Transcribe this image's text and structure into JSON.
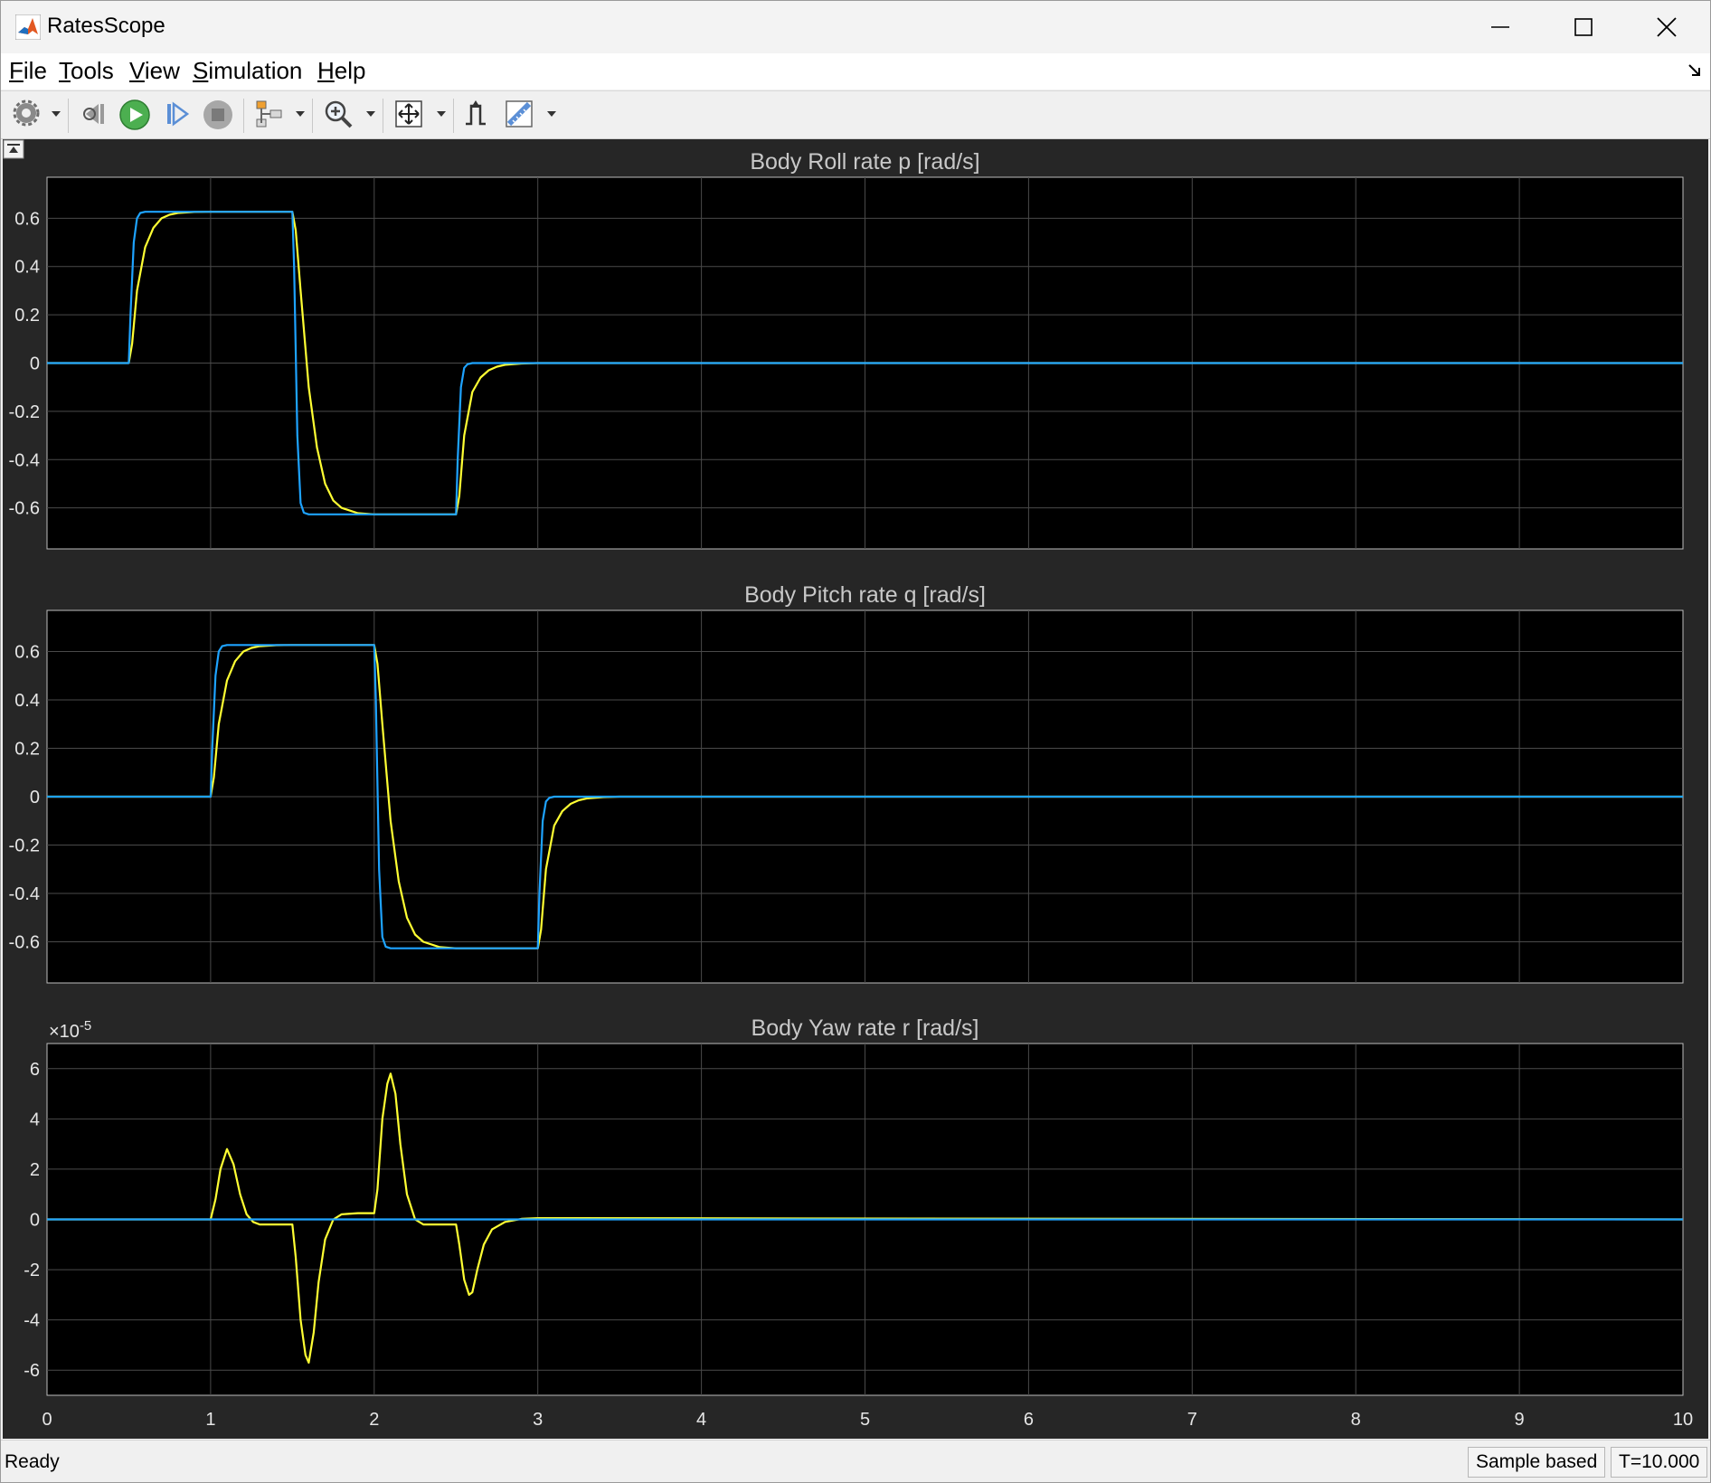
{
  "window": {
    "title": "RatesScope"
  },
  "menu": [
    {
      "pre": "",
      "ul": "F",
      "post": "ile"
    },
    {
      "pre": "",
      "ul": "T",
      "post": "ools"
    },
    {
      "pre": "",
      "ul": "V",
      "post": "iew"
    },
    {
      "pre": "",
      "ul": "S",
      "post": "imulation"
    },
    {
      "pre": "",
      "ul": "H",
      "post": "elp"
    }
  ],
  "toolbar": {
    "buttons": [
      "settings-icon",
      "step-back-icon",
      "run-icon",
      "step-forward-icon",
      "stop-icon",
      "signal-select-icon",
      "zoom-in-icon",
      "autoscale-icon",
      "triggers-icon",
      "measurements-icon"
    ]
  },
  "status": {
    "text": "Ready",
    "mode": "Sample based",
    "time": "T=10.000"
  },
  "colors": {
    "setpoint": "#1ea3ff",
    "response": "#ffff33",
    "background": "#000000",
    "frame": "#262626"
  },
  "chart_data": [
    {
      "type": "line",
      "title": "Body Roll rate p [rad/s]",
      "xlim": [
        0,
        10
      ],
      "ylim": [
        -0.77,
        0.77
      ],
      "yticks": [
        -0.6,
        -0.4,
        -0.2,
        0,
        0.2,
        0.4,
        0.6
      ],
      "ytick_labels": [
        "-0.6",
        "-0.4",
        "-0.2",
        "0",
        "0.2",
        "0.4",
        "0.6"
      ],
      "grid": true,
      "series": [
        {
          "color": "#ffff33",
          "x": [
            0,
            0.5,
            0.52,
            0.55,
            0.6,
            0.65,
            0.7,
            0.75,
            0.8,
            0.9,
            1.0,
            1.5,
            1.52,
            1.55,
            1.6,
            1.65,
            1.7,
            1.75,
            1.8,
            1.9,
            2.0,
            2.5,
            2.52,
            2.55,
            2.6,
            2.65,
            2.7,
            2.75,
            2.8,
            2.9,
            3.0,
            10
          ],
          "y": [
            0,
            0,
            0.08,
            0.3,
            0.48,
            0.56,
            0.6,
            0.615,
            0.622,
            0.626,
            0.627,
            0.627,
            0.55,
            0.3,
            -0.1,
            -0.35,
            -0.5,
            -0.57,
            -0.6,
            -0.622,
            -0.627,
            -0.627,
            -0.55,
            -0.3,
            -0.12,
            -0.06,
            -0.03,
            -0.015,
            -0.007,
            -0.002,
            0,
            0
          ]
        },
        {
          "color": "#1ea3ff",
          "x": [
            0,
            0.5,
            0.51,
            0.53,
            0.55,
            0.57,
            0.6,
            1.5,
            1.51,
            1.53,
            1.55,
            1.57,
            1.6,
            2.5,
            2.51,
            2.53,
            2.55,
            2.57,
            2.6,
            10
          ],
          "y": [
            0,
            0,
            0.2,
            0.5,
            0.6,
            0.622,
            0.627,
            0.627,
            0.4,
            -0.3,
            -0.58,
            -0.62,
            -0.627,
            -0.627,
            -0.4,
            -0.1,
            -0.02,
            -0.005,
            0,
            0
          ]
        }
      ]
    },
    {
      "type": "line",
      "title": "Body Pitch rate q [rad/s]",
      "xlim": [
        0,
        10
      ],
      "ylim": [
        -0.77,
        0.77
      ],
      "yticks": [
        -0.6,
        -0.4,
        -0.2,
        0,
        0.2,
        0.4,
        0.6
      ],
      "ytick_labels": [
        "-0.6",
        "-0.4",
        "-0.2",
        "0",
        "0.2",
        "0.4",
        "0.6"
      ],
      "grid": true,
      "series": [
        {
          "color": "#ffff33",
          "x": [
            0,
            1.0,
            1.02,
            1.05,
            1.1,
            1.15,
            1.2,
            1.25,
            1.3,
            1.4,
            1.5,
            2.0,
            2.02,
            2.05,
            2.1,
            2.15,
            2.2,
            2.25,
            2.3,
            2.4,
            2.5,
            3.0,
            3.02,
            3.05,
            3.1,
            3.15,
            3.2,
            3.25,
            3.3,
            3.4,
            3.5,
            10
          ],
          "y": [
            0,
            0,
            0.08,
            0.3,
            0.48,
            0.56,
            0.6,
            0.615,
            0.622,
            0.626,
            0.627,
            0.627,
            0.55,
            0.3,
            -0.1,
            -0.35,
            -0.5,
            -0.57,
            -0.6,
            -0.622,
            -0.627,
            -0.627,
            -0.55,
            -0.3,
            -0.12,
            -0.06,
            -0.03,
            -0.015,
            -0.007,
            -0.002,
            0,
            0
          ]
        },
        {
          "color": "#1ea3ff",
          "x": [
            0,
            1.0,
            1.01,
            1.03,
            1.05,
            1.07,
            1.1,
            2.0,
            2.01,
            2.03,
            2.05,
            2.07,
            2.1,
            3.0,
            3.01,
            3.03,
            3.05,
            3.07,
            3.1,
            10
          ],
          "y": [
            0,
            0,
            0.2,
            0.5,
            0.6,
            0.622,
            0.627,
            0.627,
            0.4,
            -0.3,
            -0.58,
            -0.62,
            -0.627,
            -0.627,
            -0.4,
            -0.1,
            -0.02,
            -0.005,
            0,
            0
          ]
        }
      ]
    },
    {
      "type": "line",
      "title": "Body Yaw rate r [rad/s]",
      "exponent_label": "×10",
      "exponent_power": "-5",
      "xlim": [
        0,
        10
      ],
      "ylim": [
        -7,
        7
      ],
      "yticks": [
        -6,
        -4,
        -2,
        0,
        2,
        4,
        6
      ],
      "ytick_labels": [
        "-6",
        "-4",
        "-2",
        "0",
        "2",
        "4",
        "6"
      ],
      "xticks": [
        0,
        1,
        2,
        3,
        4,
        5,
        6,
        7,
        8,
        9,
        10
      ],
      "xtick_labels": [
        "0",
        "1",
        "2",
        "3",
        "4",
        "5",
        "6",
        "7",
        "8",
        "9",
        "10"
      ],
      "grid": true,
      "series": [
        {
          "color": "#ffff33",
          "x": [
            0,
            1.0,
            1.03,
            1.06,
            1.1,
            1.14,
            1.18,
            1.22,
            1.26,
            1.3,
            1.35,
            1.4,
            1.5,
            1.52,
            1.55,
            1.58,
            1.6,
            1.63,
            1.66,
            1.7,
            1.75,
            1.8,
            1.9,
            2.0,
            2.02,
            2.05,
            2.08,
            2.1,
            2.13,
            2.16,
            2.2,
            2.25,
            2.3,
            2.4,
            2.5,
            2.52,
            2.55,
            2.58,
            2.6,
            2.63,
            2.67,
            2.72,
            2.8,
            2.9,
            3.0,
            10
          ],
          "y": [
            0,
            0,
            0.8,
            2.0,
            2.8,
            2.2,
            1.0,
            0.2,
            -0.1,
            -0.2,
            -0.2,
            -0.2,
            -0.2,
            -1.5,
            -4.0,
            -5.4,
            -5.7,
            -4.5,
            -2.5,
            -0.8,
            0.0,
            0.2,
            0.25,
            0.25,
            1.2,
            4.0,
            5.4,
            5.8,
            5.0,
            3.0,
            1.0,
            0.0,
            -0.2,
            -0.2,
            -0.2,
            -1.0,
            -2.4,
            -3.0,
            -2.9,
            -2.0,
            -1.0,
            -0.4,
            -0.1,
            0.02,
            0.05,
            0
          ]
        },
        {
          "color": "#1ea3ff",
          "x": [
            0,
            10
          ],
          "y": [
            0,
            0
          ]
        }
      ]
    }
  ]
}
